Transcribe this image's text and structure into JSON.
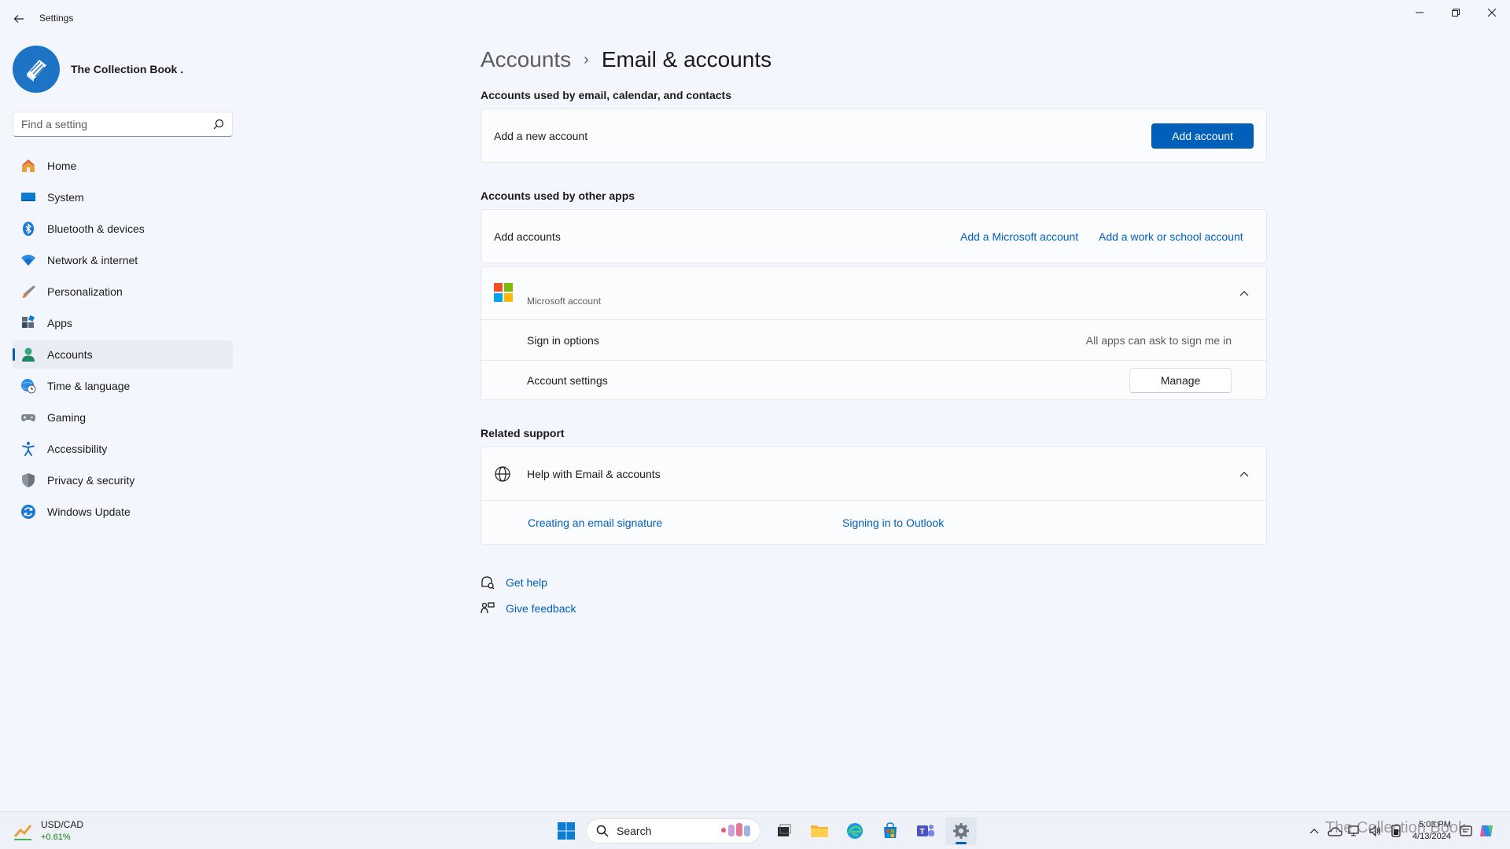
{
  "window": {
    "title": "Settings"
  },
  "profile": {
    "name": "The Collection Book ."
  },
  "search": {
    "placeholder": "Find a setting"
  },
  "sidebar": {
    "items": [
      {
        "label": "Home",
        "icon": "home-icon"
      },
      {
        "label": "System",
        "icon": "system-icon"
      },
      {
        "label": "Bluetooth & devices",
        "icon": "bluetooth-icon"
      },
      {
        "label": "Network & internet",
        "icon": "wifi-icon"
      },
      {
        "label": "Personalization",
        "icon": "brush-icon"
      },
      {
        "label": "Apps",
        "icon": "apps-icon"
      },
      {
        "label": "Accounts",
        "icon": "person-icon",
        "active": true
      },
      {
        "label": "Time & language",
        "icon": "globe-clock-icon"
      },
      {
        "label": "Gaming",
        "icon": "gamepad-icon"
      },
      {
        "label": "Accessibility",
        "icon": "accessibility-icon"
      },
      {
        "label": "Privacy & security",
        "icon": "shield-icon"
      },
      {
        "label": "Windows Update",
        "icon": "update-icon"
      }
    ]
  },
  "breadcrumb": {
    "parent": "Accounts",
    "separator": "›",
    "current": "Email & accounts"
  },
  "email_section": {
    "title": "Accounts used by email, calendar, and contacts",
    "row_label": "Add a new account",
    "button": "Add account"
  },
  "other_apps_section": {
    "title": "Accounts used by other apps",
    "row_label": "Add accounts",
    "link_microsoft": "Add a Microsoft account",
    "link_work": "Add a work or school account"
  },
  "microsoft_account": {
    "label": "Microsoft account",
    "sign_in_label": "Sign in options",
    "sign_in_value": "All apps can ask to sign me in",
    "settings_label": "Account settings",
    "manage_button": "Manage"
  },
  "related_support": {
    "title": "Related support",
    "help_title": "Help with Email & accounts",
    "links": [
      "Creating an email signature",
      "Signing in to Outlook"
    ]
  },
  "footer": {
    "get_help": "Get help",
    "give_feedback": "Give feedback"
  },
  "taskbar": {
    "widget_title": "USD/CAD",
    "widget_value": "+0.61%",
    "search_label": "Search",
    "time": "5:03 PM",
    "date": "4/13/2024"
  },
  "watermark": "The Collection Book",
  "colors": {
    "accent": "#005fb8",
    "background": "#f3f6fc",
    "card": "#fbfcfe"
  }
}
